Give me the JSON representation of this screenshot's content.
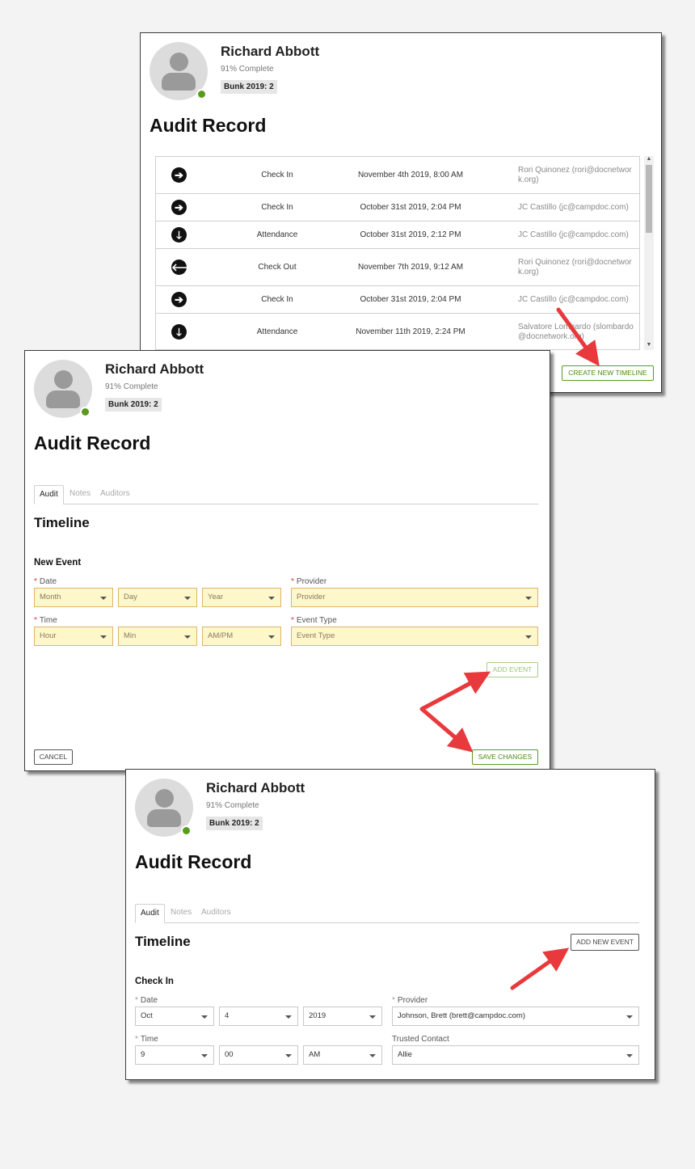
{
  "profile": {
    "name": "Richard Abbott",
    "complete": "91% Complete",
    "bunk": "Bunk 2019: 2"
  },
  "page_title": "Audit Record",
  "panel1": {
    "rows": [
      {
        "icon": "arrow-right-icon",
        "glyph": "➔",
        "event": "Check In",
        "date": "November 4th 2019, 8:00 AM",
        "provider": "Rori Quinonez (rori@docnetwork.org)"
      },
      {
        "icon": "arrow-right-icon",
        "glyph": "➔",
        "event": "Check In",
        "date": "October 31st 2019, 2:04 PM",
        "provider": "JC Castillo (jc@campdoc.com)"
      },
      {
        "icon": "arrow-down-icon",
        "glyph": "🡓",
        "event": "Attendance",
        "date": "October 31st 2019, 2:12 PM",
        "provider": "JC Castillo (jc@campdoc.com)"
      },
      {
        "icon": "arrow-left-icon",
        "glyph": "🡐",
        "event": "Check Out",
        "date": "November 7th 2019, 9:12 AM",
        "provider": "Rori Quinonez (rori@docnetwork.org)"
      },
      {
        "icon": "arrow-right-icon",
        "glyph": "➔",
        "event": "Check In",
        "date": "October 31st 2019, 2:04 PM",
        "provider": "JC Castillo (jc@campdoc.com)"
      },
      {
        "icon": "arrow-down-icon",
        "glyph": "🡓",
        "event": "Attendance",
        "date": "November 11th 2019, 2:24 PM",
        "provider": "Salvatore Lombardo (slombardo@docnetwork.org)"
      }
    ],
    "create_timeline_label": "CREATE NEW TIMELINE"
  },
  "tabs": [
    "Audit",
    "Notes",
    "Auditors"
  ],
  "timeline_heading": "Timeline",
  "panel2": {
    "section_title": "New Event",
    "date_label": "Date",
    "time_label": "Time",
    "provider_label": "Provider",
    "event_type_label": "Event Type",
    "month_placeholder": "Month",
    "day_placeholder": "Day",
    "year_placeholder": "Year",
    "hour_placeholder": "Hour",
    "min_placeholder": "Min",
    "ampm_placeholder": "AM/PM",
    "provider_placeholder": "Provider",
    "event_type_placeholder": "Event Type",
    "add_event_label": "ADD EVENT",
    "cancel_label": "CANCEL",
    "save_label": "SAVE CHANGES"
  },
  "panel3": {
    "add_new_event_label": "ADD NEW EVENT",
    "section_title": "Check In",
    "date_label": "Date",
    "time_label": "Time",
    "provider_label": "Provider",
    "trusted_contact_label": "Trusted Contact",
    "month_value": "Oct",
    "day_value": "4",
    "year_value": "2019",
    "hour_value": "9",
    "min_value": "00",
    "ampm_value": "AM",
    "provider_value": "Johnson, Brett (brett@campdoc.com)",
    "trusted_contact_value": "Allie"
  },
  "colors": {
    "accent_green": "#5a9b1c",
    "annotation_arrow": "#e8393c",
    "invalid_field_bg": "#fdf7c9",
    "required_star": "#d9342b"
  }
}
